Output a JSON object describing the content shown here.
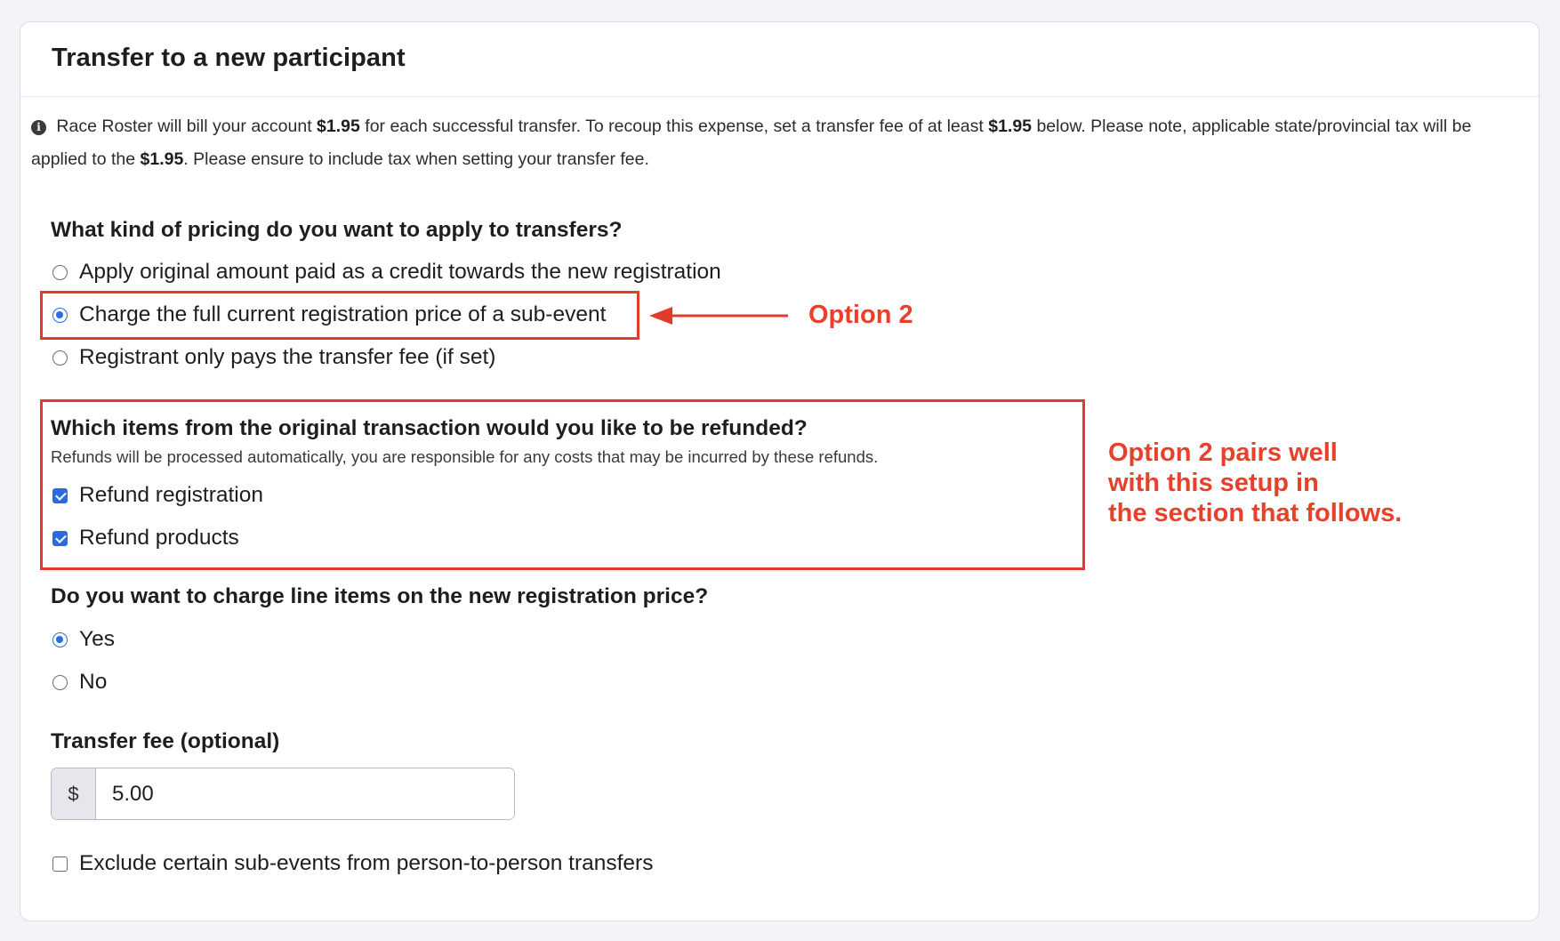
{
  "card": {
    "title": "Transfer to a new participant"
  },
  "info": {
    "icon": "i",
    "part1": " Race Roster will bill your account ",
    "amount1": "$1.95",
    "part2": " for each successful transfer. To recoup this expense, set a transfer fee of at least ",
    "amount2": "$1.95",
    "part3": " below. Please note, applicable state/provincial tax will be applied to the ",
    "amount3": "$1.95",
    "part4": ". Please ensure to include tax when setting your transfer fee."
  },
  "pricing": {
    "question": "What kind of pricing do you want to apply to transfers?",
    "options": [
      {
        "label": "Apply original amount paid as a credit towards the new registration",
        "checked": false
      },
      {
        "label": "Charge the full current registration price of a sub-event",
        "checked": true
      },
      {
        "label": "Registrant only pays the transfer fee (if set)",
        "checked": false
      }
    ]
  },
  "refunds": {
    "question": "Which items from the original transaction would you like to be refunded?",
    "hint": "Refunds will be processed automatically, you are responsible for any costs that may be incurred by these refunds.",
    "options": [
      {
        "label": "Refund registration",
        "checked": true
      },
      {
        "label": "Refund products",
        "checked": true
      }
    ]
  },
  "line_items": {
    "question": "Do you want to charge line items on the new registration price?",
    "options": [
      {
        "label": "Yes",
        "checked": true
      },
      {
        "label": "No",
        "checked": false
      }
    ]
  },
  "transfer_fee": {
    "label": "Transfer fee (optional)",
    "currency_symbol": "$",
    "value": "5.00"
  },
  "exclude": {
    "label": "Exclude certain sub-events from person-to-person transfers",
    "checked": false
  },
  "annotations": {
    "option2": "Option 2",
    "pairs_line1": "Option 2 pairs well",
    "pairs_line2": "with this setup in",
    "pairs_line3": "the section that follows."
  },
  "colors": {
    "accent": "#2a6cdf",
    "annotation_red": "#e23b2b"
  }
}
